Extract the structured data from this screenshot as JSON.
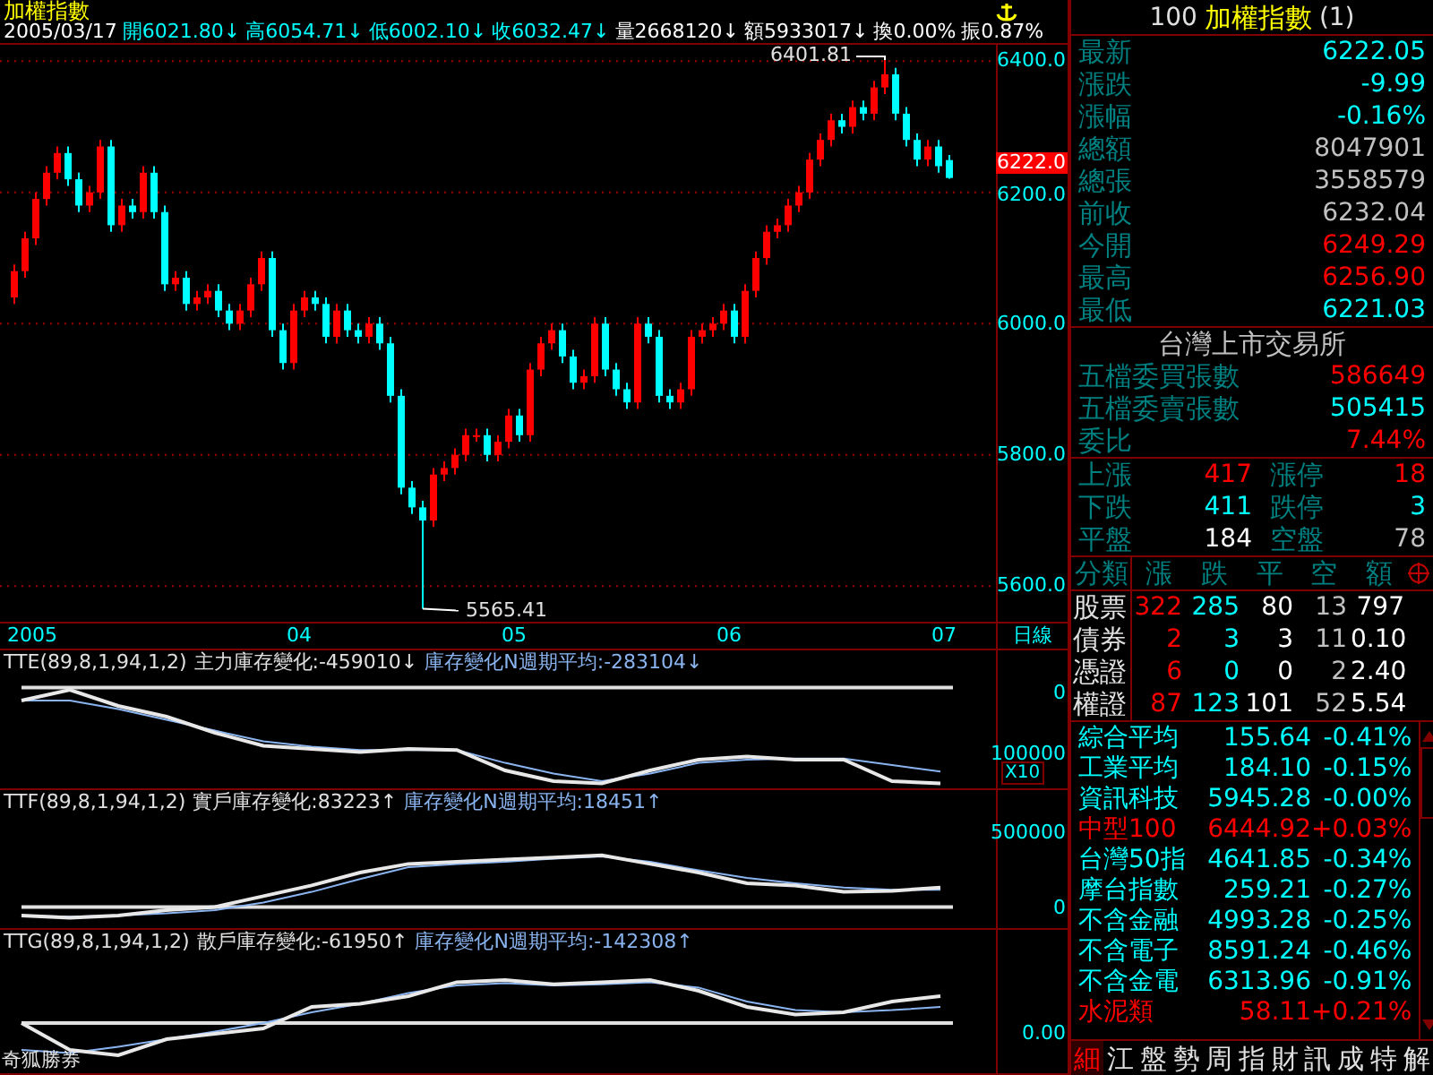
{
  "header": {
    "title": "加權指數",
    "items": [
      {
        "text": "2005/03/17",
        "color": "#ffffff"
      },
      {
        "text": "開6021.80↓",
        "color": "#00ffff"
      },
      {
        "text": "高6054.71↓",
        "color": "#00ffff"
      },
      {
        "text": "低6002.10↓",
        "color": "#00ffff"
      },
      {
        "text": "收6032.47↓",
        "color": "#00ffff"
      },
      {
        "text": "量2668120↓",
        "color": "#ffffff"
      },
      {
        "text": "額5933017↓",
        "color": "#ffffff"
      },
      {
        "text": "換0.00%",
        "color": "#ffffff"
      },
      {
        "text": "振0.87%",
        "color": "#ffffff"
      }
    ]
  },
  "main_chart": {
    "high_label": "6401.81",
    "low_label": "5565.41",
    "current_price": "6222.0",
    "date_axis": {
      "labels": [
        "2005",
        "04",
        "05",
        "06",
        "07"
      ],
      "period": "日線"
    },
    "chart_data": {
      "type": "candlestick",
      "ylim": [
        5543,
        6425
      ],
      "grid": true,
      "yticks": [
        {
          "value": 6400,
          "label": "6400.0"
        },
        {
          "value": 6200,
          "label": "6200.0"
        },
        {
          "value": 6000,
          "label": "6000.0"
        },
        {
          "value": 5800,
          "label": "5800.0"
        },
        {
          "value": 5600,
          "label": "5600.0"
        }
      ],
      "ohlc": [
        [
          6040,
          6090,
          6030,
          6080
        ],
        [
          6080,
          6140,
          6070,
          6130
        ],
        [
          6130,
          6200,
          6120,
          6190
        ],
        [
          6190,
          6240,
          6180,
          6230
        ],
        [
          6230,
          6270,
          6220,
          6260
        ],
        [
          6260,
          6270,
          6210,
          6220
        ],
        [
          6220,
          6230,
          6170,
          6180
        ],
        [
          6180,
          6210,
          6170,
          6200
        ],
        [
          6200,
          6280,
          6190,
          6270
        ],
        [
          6270,
          6280,
          6140,
          6150
        ],
        [
          6150,
          6190,
          6140,
          6180
        ],
        [
          6180,
          6190,
          6160,
          6170
        ],
        [
          6170,
          6240,
          6160,
          6230
        ],
        [
          6230,
          6240,
          6160,
          6170
        ],
        [
          6170,
          6180,
          6050,
          6060
        ],
        [
          6060,
          6080,
          6050,
          6070
        ],
        [
          6070,
          6080,
          6020,
          6030
        ],
        [
          6030,
          6050,
          6020,
          6040
        ],
        [
          6040,
          6060,
          6030,
          6050
        ],
        [
          6050,
          6060,
          6010,
          6020
        ],
        [
          6020,
          6030,
          5990,
          6000
        ],
        [
          6000,
          6030,
          5990,
          6020
        ],
        [
          6020,
          6070,
          6010,
          6060
        ],
        [
          6060,
          6110,
          6050,
          6100
        ],
        [
          6100,
          6110,
          5980,
          5990
        ],
        [
          5990,
          6000,
          5930,
          5940
        ],
        [
          5940,
          6030,
          5930,
          6020
        ],
        [
          6020,
          6050,
          6010,
          6040
        ],
        [
          6040,
          6050,
          6020,
          6030
        ],
        [
          6030,
          6040,
          5970,
          5980
        ],
        [
          5980,
          6030,
          5970,
          6020
        ],
        [
          6020,
          6030,
          5980,
          5990
        ],
        [
          5990,
          6000,
          5970,
          5980
        ],
        [
          5980,
          6010,
          5970,
          6000
        ],
        [
          6000,
          6010,
          5960,
          5970
        ],
        [
          5970,
          5980,
          5880,
          5890
        ],
        [
          5890,
          5900,
          5740,
          5750
        ],
        [
          5750,
          5760,
          5710,
          5720
        ],
        [
          5720,
          5730,
          5565.41,
          5700
        ],
        [
          5700,
          5780,
          5690,
          5770
        ],
        [
          5770,
          5790,
          5760,
          5780
        ],
        [
          5780,
          5810,
          5770,
          5800
        ],
        [
          5800,
          5840,
          5790,
          5830
        ],
        [
          5830,
          5840,
          5820,
          5830
        ],
        [
          5830,
          5840,
          5790,
          5800
        ],
        [
          5800,
          5830,
          5790,
          5820
        ],
        [
          5820,
          5870,
          5810,
          5860
        ],
        [
          5860,
          5870,
          5820,
          5830
        ],
        [
          5830,
          5940,
          5820,
          5930
        ],
        [
          5930,
          5980,
          5920,
          5970
        ],
        [
          5970,
          6000,
          5960,
          5990
        ],
        [
          5990,
          6000,
          5940,
          5950
        ],
        [
          5950,
          5960,
          5900,
          5910
        ],
        [
          5910,
          5930,
          5900,
          5920
        ],
        [
          5920,
          6010,
          5910,
          6000
        ],
        [
          6000,
          6010,
          5920,
          5930
        ],
        [
          5930,
          5940,
          5890,
          5900
        ],
        [
          5900,
          5910,
          5870,
          5880
        ],
        [
          5880,
          6010,
          5870,
          6000
        ],
        [
          6000,
          6010,
          5970,
          5980
        ],
        [
          5980,
          5990,
          5880,
          5890
        ],
        [
          5890,
          5900,
          5870,
          5880
        ],
        [
          5880,
          5910,
          5870,
          5900
        ],
        [
          5900,
          5990,
          5890,
          5980
        ],
        [
          5980,
          6000,
          5970,
          5990
        ],
        [
          5990,
          6010,
          5980,
          6000
        ],
        [
          6000,
          6030,
          5990,
          6020
        ],
        [
          6020,
          6030,
          5970,
          5980
        ],
        [
          5980,
          6060,
          5970,
          6050
        ],
        [
          6050,
          6110,
          6040,
          6100
        ],
        [
          6100,
          6150,
          6090,
          6140
        ],
        [
          6140,
          6160,
          6130,
          6150
        ],
        [
          6150,
          6190,
          6140,
          6180
        ],
        [
          6180,
          6210,
          6170,
          6200
        ],
        [
          6200,
          6260,
          6190,
          6250
        ],
        [
          6250,
          6290,
          6240,
          6280
        ],
        [
          6280,
          6320,
          6270,
          6310
        ],
        [
          6310,
          6320,
          6290,
          6300
        ],
        [
          6300,
          6340,
          6290,
          6330
        ],
        [
          6330,
          6340,
          6310,
          6320
        ],
        [
          6320,
          6370,
          6310,
          6360
        ],
        [
          6360,
          6401.81,
          6350,
          6380
        ],
        [
          6380,
          6390,
          6310,
          6320
        ],
        [
          6320,
          6330,
          6270,
          6280
        ],
        [
          6280,
          6290,
          6240,
          6250
        ],
        [
          6250,
          6280,
          6240,
          6270
        ],
        [
          6270,
          6280,
          6230,
          6240
        ],
        [
          6249.29,
          6256.9,
          6221.03,
          6222.05
        ]
      ]
    }
  },
  "indicators": [
    {
      "formula": "TTE(89,8,1,94,1,2)",
      "name": "主力庫存變化:-459010↓",
      "average": "庫存變化N週期平均:-283104↓",
      "scale": [
        "0",
        "100000"
      ],
      "unit": "X10"
    },
    {
      "formula": "TTF(89,8,1,94,1,2)",
      "name": "實戶庫存變化:83223↑",
      "average": "庫存變化N週期平均:18451↑",
      "scale": [
        "500000",
        "0"
      ]
    },
    {
      "formula": "TTG(89,8,1,94,1,2)",
      "name": "散戶庫存變化:-61950↑",
      "average": "庫存變化N週期平均:-142308↑",
      "scale": [
        "0.00"
      ]
    }
  ],
  "footer_brand": "奇狐勝券",
  "quote_panel": {
    "code": "100",
    "name": "加權指數",
    "suffix": "(1)",
    "rows": [
      {
        "label": "最新",
        "value": "6222.05",
        "color": "#00ffff"
      },
      {
        "label": "漲跌",
        "value": "-9.99",
        "color": "#00ffff"
      },
      {
        "label": "漲幅",
        "value": "-0.16%",
        "color": "#00ffff"
      },
      {
        "label": "總額",
        "value": "8047901",
        "color": "#c0c0c0"
      },
      {
        "label": "總張",
        "value": "3558579",
        "color": "#c0c0c0"
      },
      {
        "label": "前收",
        "value": "6232.04",
        "color": "#c0c0c0"
      },
      {
        "label": "今開",
        "value": "6249.29",
        "color": "#ff0000"
      },
      {
        "label": "最高",
        "value": "6256.90",
        "color": "#ff0000"
      },
      {
        "label": "最低",
        "value": "6221.03",
        "color": "#00ffff"
      }
    ]
  },
  "exchange": {
    "title": "台灣上市交易所",
    "rows": [
      {
        "label": "五檔委買張數",
        "value": "586649",
        "color": "#ff0000"
      },
      {
        "label": "五檔委賣張數",
        "value": "505415",
        "color": "#00ffff"
      },
      {
        "label": "委比",
        "value": "7.44%",
        "color": "#ff0000"
      }
    ]
  },
  "breadth": [
    {
      "cells": [
        {
          "label": "上漲",
          "value": "417",
          "color": "#ff0000"
        },
        {
          "label": "漲停",
          "value": "18",
          "color": "#ff0000"
        }
      ]
    },
    {
      "cells": [
        {
          "label": "下跌",
          "value": "411",
          "color": "#00ffff"
        },
        {
          "label": "跌停",
          "value": "3",
          "color": "#00ffff"
        }
      ]
    },
    {
      "cells": [
        {
          "label": "平盤",
          "value": "184",
          "color": "#ffffff"
        },
        {
          "label": "空盤",
          "value": "78",
          "color": "#c0c0c0"
        }
      ]
    }
  ],
  "category_table": {
    "columns": [
      "分類",
      "漲",
      "跌",
      "平",
      "空",
      "額"
    ],
    "rows": [
      [
        "股票",
        "322",
        "285",
        "80",
        "13",
        "797"
      ],
      [
        "債券",
        "2",
        "3",
        "3",
        "11",
        "0.10"
      ],
      [
        "憑證",
        "6",
        "0",
        "0",
        "2",
        "2.40"
      ],
      [
        "權證",
        "87",
        "123",
        "101",
        "52",
        "5.54"
      ]
    ]
  },
  "indices": [
    {
      "name": "綜合平均",
      "value": "155.64",
      "change": "-0.41%",
      "color": "#00ffff"
    },
    {
      "name": "工業平均",
      "value": "184.10",
      "change": "-0.15%",
      "color": "#00ffff"
    },
    {
      "name": "資訊科技",
      "value": "5945.28",
      "change": "-0.00%",
      "color": "#00ffff"
    },
    {
      "name": "中型100",
      "value": "6444.92",
      "change": "+0.03%",
      "color": "#ff0000"
    },
    {
      "name": "台灣50指",
      "value": "4641.85",
      "change": "-0.34%",
      "color": "#00ffff"
    },
    {
      "name": "摩台指數",
      "value": "259.21",
      "change": "-0.27%",
      "color": "#00ffff"
    },
    {
      "name": "不含金融",
      "value": "4993.28",
      "change": "-0.25%",
      "color": "#00ffff"
    },
    {
      "name": "不含電子",
      "value": "8591.24",
      "change": "-0.46%",
      "color": "#00ffff"
    },
    {
      "name": "不含金電",
      "value": "6313.96",
      "change": "-0.91%",
      "color": "#00ffff"
    },
    {
      "name": "水泥類",
      "value": "58.11",
      "change": "+0.21%",
      "color": "#ff0000"
    }
  ],
  "bottom_tabs": [
    {
      "label": "細",
      "selected": true
    },
    {
      "label": "江",
      "selected": false
    },
    {
      "label": "盤",
      "selected": false
    },
    {
      "label": "勢",
      "selected": false
    },
    {
      "label": "周",
      "selected": false
    },
    {
      "label": "指",
      "selected": false
    },
    {
      "label": "財",
      "selected": false
    },
    {
      "label": "訊",
      "selected": false
    },
    {
      "label": "成",
      "selected": false
    },
    {
      "label": "特",
      "selected": false
    },
    {
      "label": "解",
      "selected": false
    }
  ]
}
